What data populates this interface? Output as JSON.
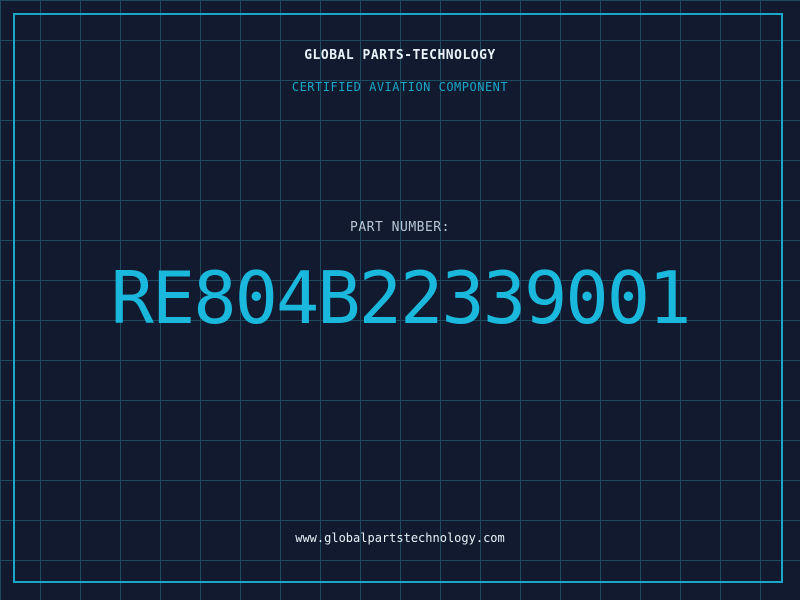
{
  "header": {
    "company": "GLOBAL PARTS-TECHNOLOGY",
    "subtitle": "CERTIFIED AVIATION COMPONENT"
  },
  "part": {
    "label": "PART NUMBER:",
    "number": "RE804B22339001"
  },
  "footer": {
    "website": "www.globalpartstechnology.com"
  },
  "colors": {
    "background": "#111a2e",
    "grid": "#1e4a5e",
    "accent": "#1aa7c9",
    "part_number": "#1ab8dd",
    "text": "#e8f2f8"
  }
}
